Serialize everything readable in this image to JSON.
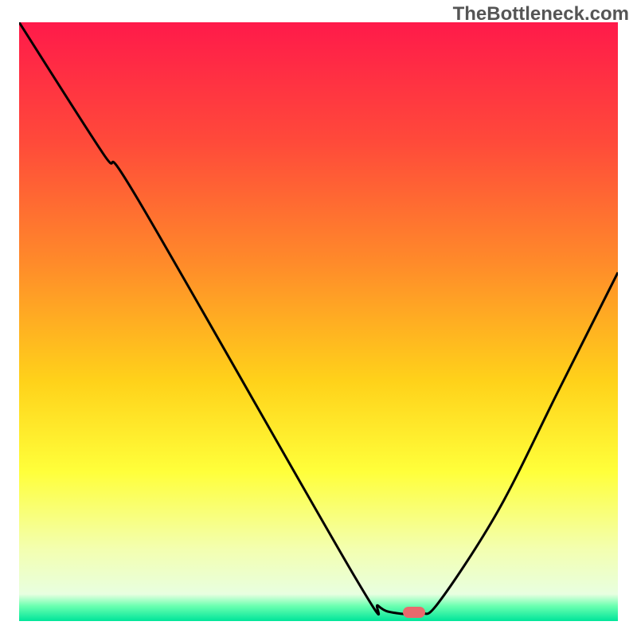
{
  "watermark": "TheBottleneck.com",
  "chart_data": {
    "type": "line",
    "title": "",
    "xlabel": "",
    "ylabel": "",
    "x_range": [
      0,
      100
    ],
    "y_range": [
      0,
      100
    ],
    "gradient_stops": [
      {
        "offset": 0,
        "color": "#ff1a4a"
      },
      {
        "offset": 0.2,
        "color": "#ff4a3a"
      },
      {
        "offset": 0.4,
        "color": "#ff8a2a"
      },
      {
        "offset": 0.6,
        "color": "#ffd21a"
      },
      {
        "offset": 0.75,
        "color": "#ffff3a"
      },
      {
        "offset": 0.88,
        "color": "#f3ffb0"
      },
      {
        "offset": 0.955,
        "color": "#e8ffe0"
      },
      {
        "offset": 0.975,
        "color": "#6affb0"
      },
      {
        "offset": 1.0,
        "color": "#00e59a"
      }
    ],
    "series": [
      {
        "name": "bottleneck-curve",
        "points": [
          {
            "x": 0.0,
            "y": 100.0
          },
          {
            "x": 14.0,
            "y": 78.0
          },
          {
            "x": 20.0,
            "y": 70.0
          },
          {
            "x": 56.0,
            "y": 7.0
          },
          {
            "x": 60.0,
            "y": 2.0
          },
          {
            "x": 63.0,
            "y": 0.8
          },
          {
            "x": 67.0,
            "y": 0.8
          },
          {
            "x": 70.0,
            "y": 2.5
          },
          {
            "x": 80.0,
            "y": 18.0
          },
          {
            "x": 90.0,
            "y": 38.0
          },
          {
            "x": 100.0,
            "y": 58.0
          }
        ]
      }
    ],
    "marker": {
      "x": 66.0,
      "y": 1.0,
      "color": "#e9696d"
    },
    "axis_color": "#000000",
    "curve_color": "#000000"
  }
}
